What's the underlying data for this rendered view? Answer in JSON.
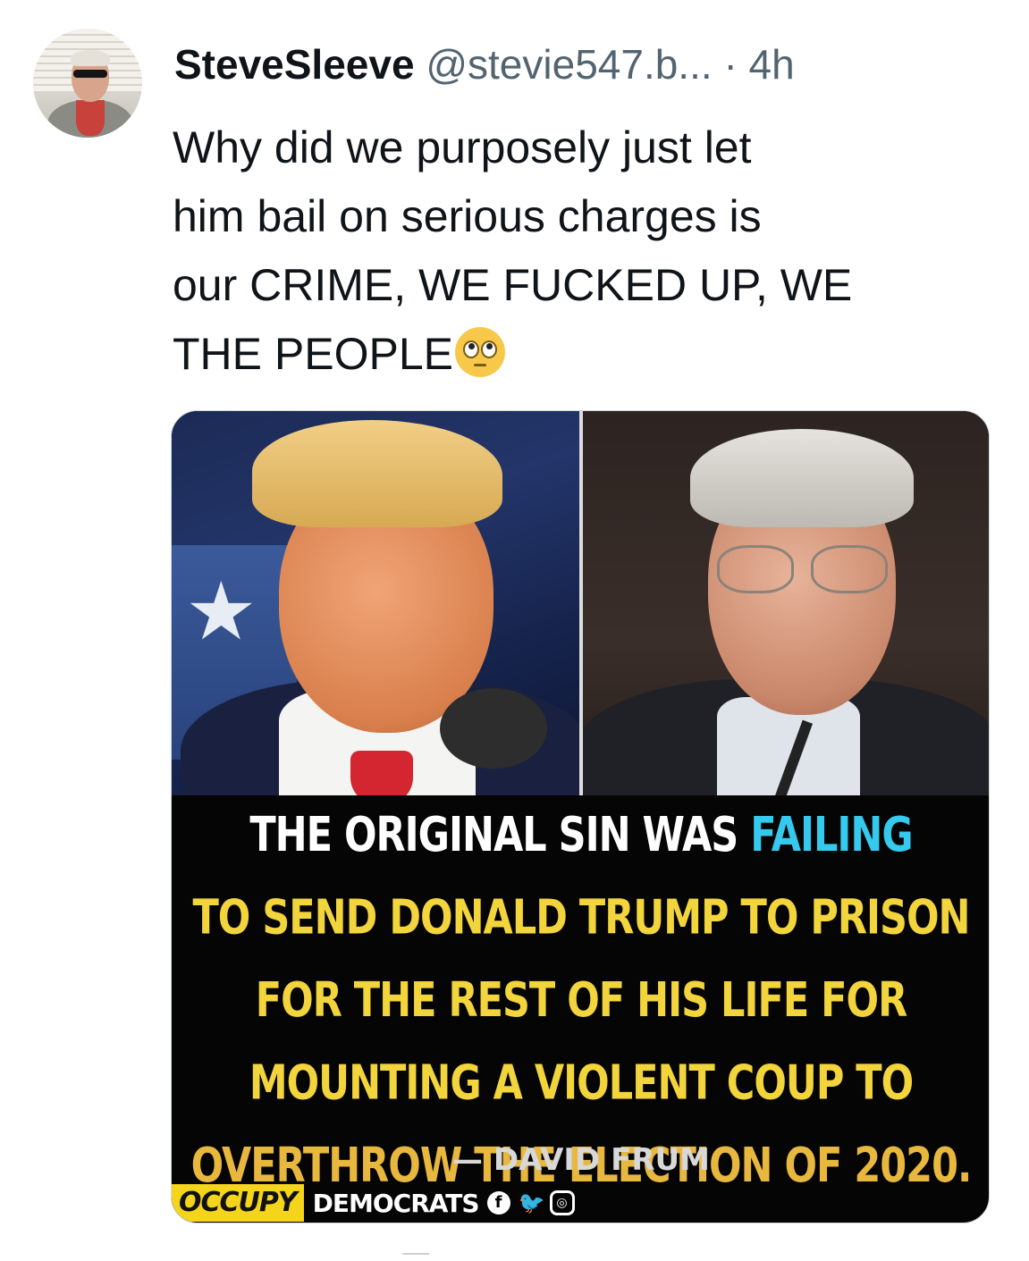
{
  "tweet": {
    "display_name": "SteveSleeve",
    "handle": "@stevie547.b...",
    "separator": "·",
    "time": "4h",
    "text_lines": [
      "Why did we purposely just let",
      "him bail on serious charges is",
      "our CRIME, WE FUCKED UP, WE",
      "THE PEOPLE"
    ],
    "emoji": "face-with-rolling-eyes"
  },
  "image": {
    "quote_line1_a": "THE ORIGINAL SIN WAS ",
    "quote_line1_b": "FAILING",
    "quote_line2": "TO SEND DONALD TRUMP TO PRISON",
    "quote_line3": "FOR THE REST OF HIS LIFE FOR",
    "quote_line4": "MOUNTING A VIOLENT COUP TO",
    "quote_line5": "OVERTHROW THE ELECTION OF 2020.",
    "attribution": "— DAVID FRUM",
    "brand_occupy": "OCCUPY",
    "brand_democrats": "DEMOCRATS",
    "social_icons": [
      "facebook-icon",
      "twitter-icon",
      "instagram-icon"
    ],
    "colors": {
      "white": "#ffffff",
      "cyan": "#35c9ee",
      "yellow": "#f2d43c",
      "gold": "#e8b83e",
      "brand_yellow": "#f5d51c"
    }
  }
}
